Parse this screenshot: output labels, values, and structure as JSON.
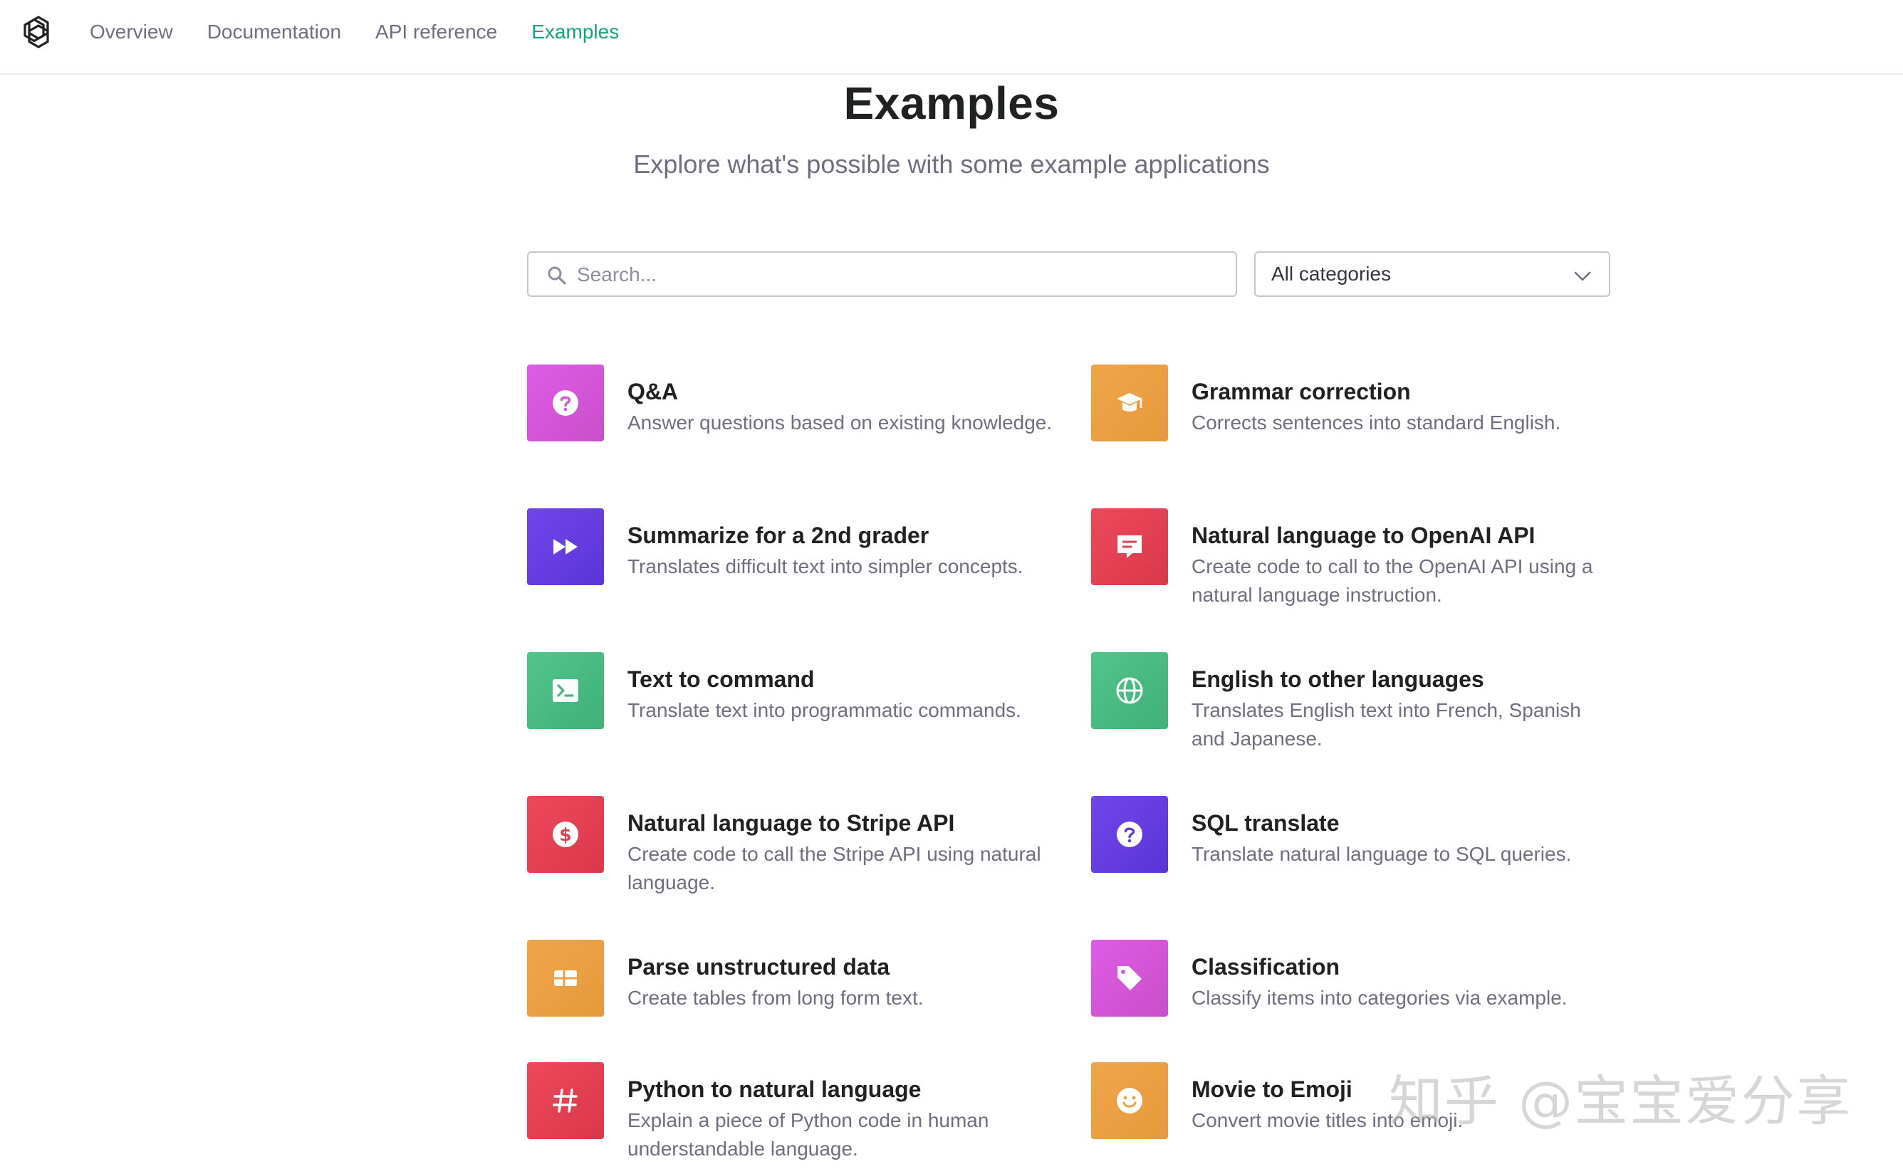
{
  "nav": {
    "items": [
      {
        "label": "Overview"
      },
      {
        "label": "Documentation"
      },
      {
        "label": "API reference"
      },
      {
        "label": "Examples",
        "active": true
      }
    ]
  },
  "header": {
    "title": "Examples",
    "subtitle": "Explore what's possible with some example applications"
  },
  "search": {
    "placeholder": "Search...",
    "value": ""
  },
  "category_select": {
    "selected": "All categories"
  },
  "examples": [
    {
      "title": "Q&A",
      "description": "Answer questions based on existing knowledge.",
      "icon": "question-icon",
      "color": "#d957d9"
    },
    {
      "title": "Grammar correction",
      "description": "Corrects sentences into standard English.",
      "icon": "graduation-cap-icon",
      "color": "#eba043"
    },
    {
      "title": "Summarize for a 2nd grader",
      "description": "Translates difficult text into simpler concepts.",
      "icon": "fast-forward-icon",
      "color": "#6840e2"
    },
    {
      "title": "Natural language to OpenAI API",
      "description": "Create code to call to the OpenAI API using a natural language instruction.",
      "icon": "chat-bubble-icon",
      "color": "#e44254"
    },
    {
      "title": "Text to command",
      "description": "Translate text into programmatic commands.",
      "icon": "terminal-icon",
      "color": "#4bbd85"
    },
    {
      "title": "English to other languages",
      "description": "Translates English text into French, Spanish and Japanese.",
      "icon": "globe-icon",
      "color": "#4bbd85"
    },
    {
      "title": "Natural language to Stripe API",
      "description": "Create code to call the Stripe API using natural language.",
      "icon": "dollar-icon",
      "color": "#e44254"
    },
    {
      "title": "SQL translate",
      "description": "Translate natural language to SQL queries.",
      "icon": "question-icon",
      "color": "#6840e2"
    },
    {
      "title": "Parse unstructured data",
      "description": "Create tables from long form text.",
      "icon": "table-icon",
      "color": "#eba043"
    },
    {
      "title": "Classification",
      "description": "Classify items into categories via example.",
      "icon": "tag-icon",
      "color": "#d957d9"
    },
    {
      "title": "Python to natural language",
      "description": "Explain a piece of Python code in human understandable language.",
      "icon": "hash-icon",
      "color": "#e44254"
    },
    {
      "title": "Movie to Emoji",
      "description": "Convert movie titles into emoji.",
      "icon": "smiley-icon",
      "color": "#eba043"
    }
  ],
  "watermark": "知乎 @宝宝爱分享"
}
